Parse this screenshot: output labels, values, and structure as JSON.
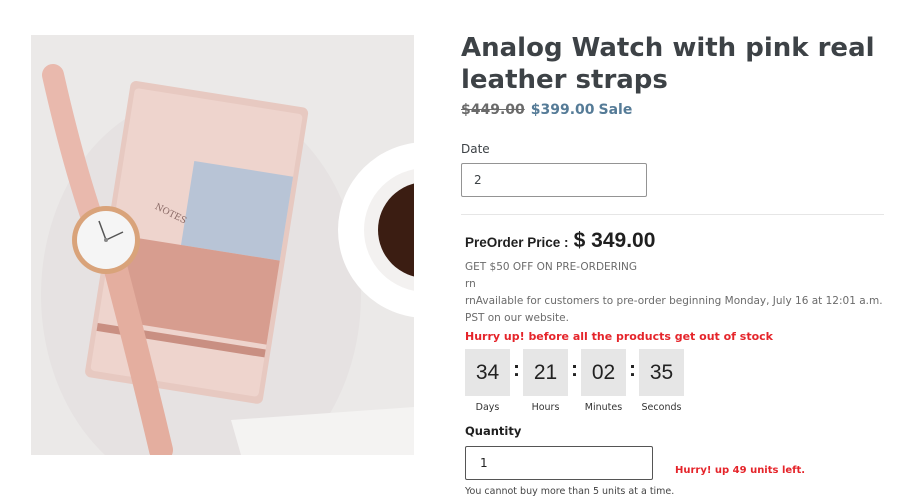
{
  "product": {
    "title": "Analog Watch with pink real leather straps",
    "compare_price": "$449.00",
    "price": "$399.00",
    "sale_label": "Sale",
    "image_notebook_text": "NOTES"
  },
  "date_field": {
    "label": "Date",
    "value": "2"
  },
  "preorder": {
    "price_label": "PreOrder Price :",
    "price": "$ 349.00",
    "offer": "GET $50 OFF ON PRE-ORDERING",
    "rn": "rn",
    "description": "rnAvailable for customers to pre-order beginning Monday, July 16 at 12:01 a.m. PST on our website.",
    "hurry_message": "Hurry up! before all the products get out of stock"
  },
  "countdown": [
    {
      "value": "34",
      "label": "Days"
    },
    {
      "value": "21",
      "label": "Hours"
    },
    {
      "value": "02",
      "label": "Minutes"
    },
    {
      "value": "35",
      "label": "Seconds"
    }
  ],
  "countdown_separator": ":",
  "quantity": {
    "label": "Quantity",
    "value": "1",
    "units_left": "Hurry! up 49 units left.",
    "limit_note": "You cannot buy more than 5 units at a time."
  },
  "colors": {
    "sale_blue": "#557b97",
    "alert_red": "#e5242a",
    "countdown_bg": "#e6e6e6"
  }
}
